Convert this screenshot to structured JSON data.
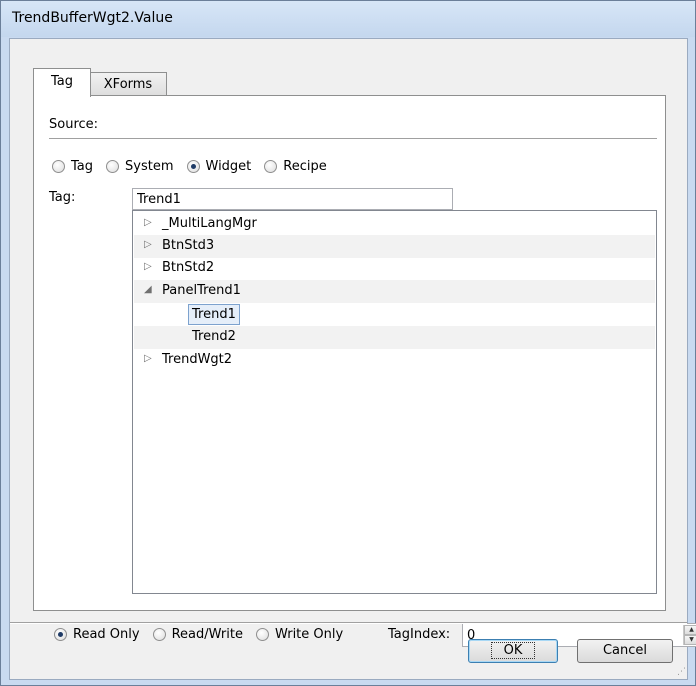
{
  "window": {
    "title": "TrendBufferWgt2.Value"
  },
  "tabs": [
    {
      "label": "Tag",
      "active": true
    },
    {
      "label": "XForms",
      "active": false
    }
  ],
  "source": {
    "label": "Source:",
    "options": [
      {
        "label": "Tag",
        "checked": false
      },
      {
        "label": "System",
        "checked": false
      },
      {
        "label": "Widget",
        "checked": true
      },
      {
        "label": "Recipe",
        "checked": false
      }
    ]
  },
  "tag": {
    "label": "Tag:",
    "value": "Trend1"
  },
  "tree": {
    "items": [
      {
        "label": "_MultiLangMgr",
        "expanded": false,
        "level": 0
      },
      {
        "label": "BtnStd3",
        "expanded": false,
        "level": 0
      },
      {
        "label": "BtnStd2",
        "expanded": false,
        "level": 0
      },
      {
        "label": "PanelTrend1",
        "expanded": true,
        "level": 0
      },
      {
        "label": "Trend1",
        "level": 1,
        "selected": true
      },
      {
        "label": "Trend2",
        "level": 1
      },
      {
        "label": "TrendWgt2",
        "expanded": false,
        "level": 0
      }
    ]
  },
  "access": {
    "options": [
      {
        "label": "Read Only",
        "checked": true
      },
      {
        "label": "Read/Write",
        "checked": false
      },
      {
        "label": "Write Only",
        "checked": false
      }
    ]
  },
  "tagindex": {
    "label": "TagIndex:",
    "value": "0"
  },
  "buttons": {
    "ok": "OK",
    "cancel": "Cancel"
  },
  "icons": {
    "collapsed": "tree-collapsed-icon",
    "expanded": "tree-expanded-icon",
    "spin_up": "spin-up-icon",
    "spin_down": "spin-down-icon"
  }
}
